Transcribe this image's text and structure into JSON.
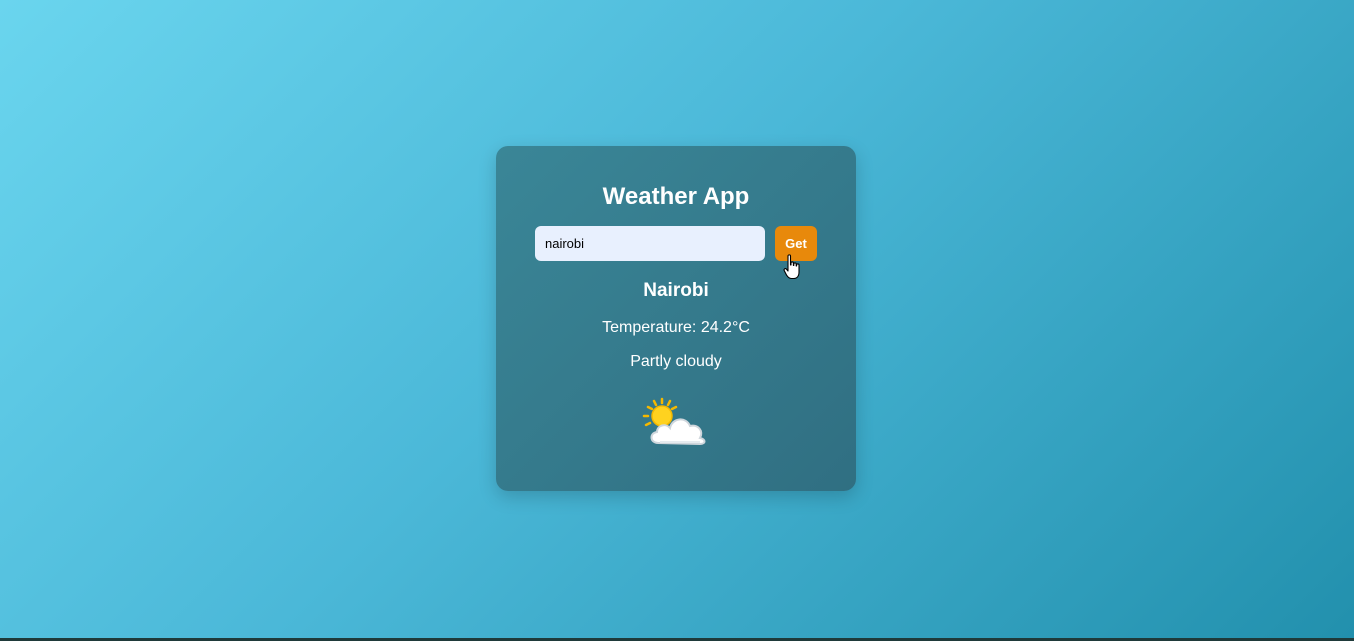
{
  "app": {
    "title": "Weather App"
  },
  "search": {
    "value": "nairobi",
    "placeholder": "",
    "button_label": "Get"
  },
  "weather": {
    "city": "Nairobi",
    "temperature_label": "Temperature:",
    "temperature_value": "24.2°C",
    "condition": "Partly cloudy",
    "icon": "partly-cloudy-icon"
  },
  "colors": {
    "background_start": "#6ad5ee",
    "background_end": "#2290ad",
    "card": "#3a8697",
    "button": "#e8890b",
    "input_bg": "#e8f0fe"
  }
}
